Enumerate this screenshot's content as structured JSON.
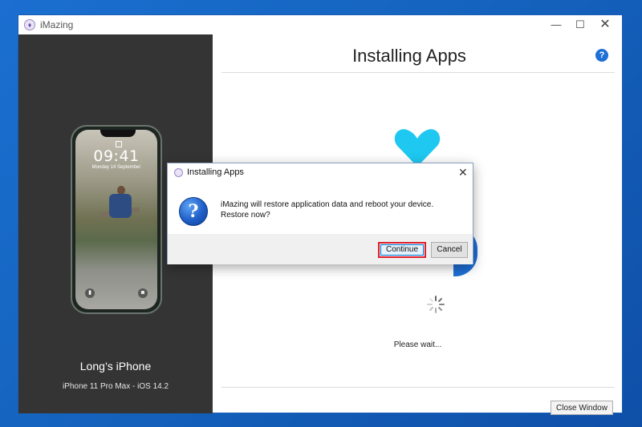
{
  "window": {
    "app_title": "iMazing",
    "controls": {
      "minimize": "—",
      "maximize": "☐",
      "close": "✕"
    }
  },
  "sidebar": {
    "device_name": "Long’s iPhone",
    "device_model": "iPhone 11 Pro Max - iOS 14.2",
    "lock_screen": {
      "time": "09:41",
      "date": "Monday 14 September"
    }
  },
  "main": {
    "title": "Installing Apps",
    "help_glyph": "?",
    "status_text": "Please wait...",
    "close_button": "Close Window"
  },
  "dialog": {
    "title": "Installing Apps",
    "close_glyph": "✕",
    "icon_glyph": "?",
    "message": "iMazing will restore application data and reboot your device. Restore now?",
    "continue_label": "Continue",
    "cancel_label": "Cancel"
  },
  "colors": {
    "accent": "#1e6fd6",
    "highlight": "#e01e2a",
    "sidebar_bg": "#343434"
  }
}
